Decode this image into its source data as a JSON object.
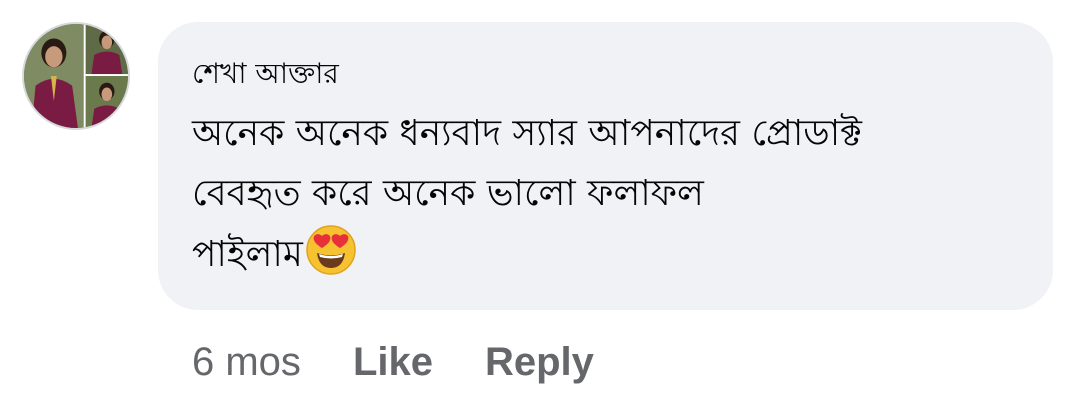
{
  "comment": {
    "author": "শেখা আক্তার",
    "lines": [
      "অনেক অনেক ধন্যবাদ স্যার আপনাদের প্রোডাক্ট",
      " বেবহৃত  করে অনেক ভালো ফলাফল",
      "পাইলাম"
    ],
    "emoji": "heart-eyes-emoji"
  },
  "actions": {
    "timestamp": "6 mos",
    "like_label": "Like",
    "reply_label": "Reply"
  },
  "colors": {
    "bubble_background": "#f0f2f5",
    "text": "#050505",
    "secondary_text": "#65676b"
  }
}
